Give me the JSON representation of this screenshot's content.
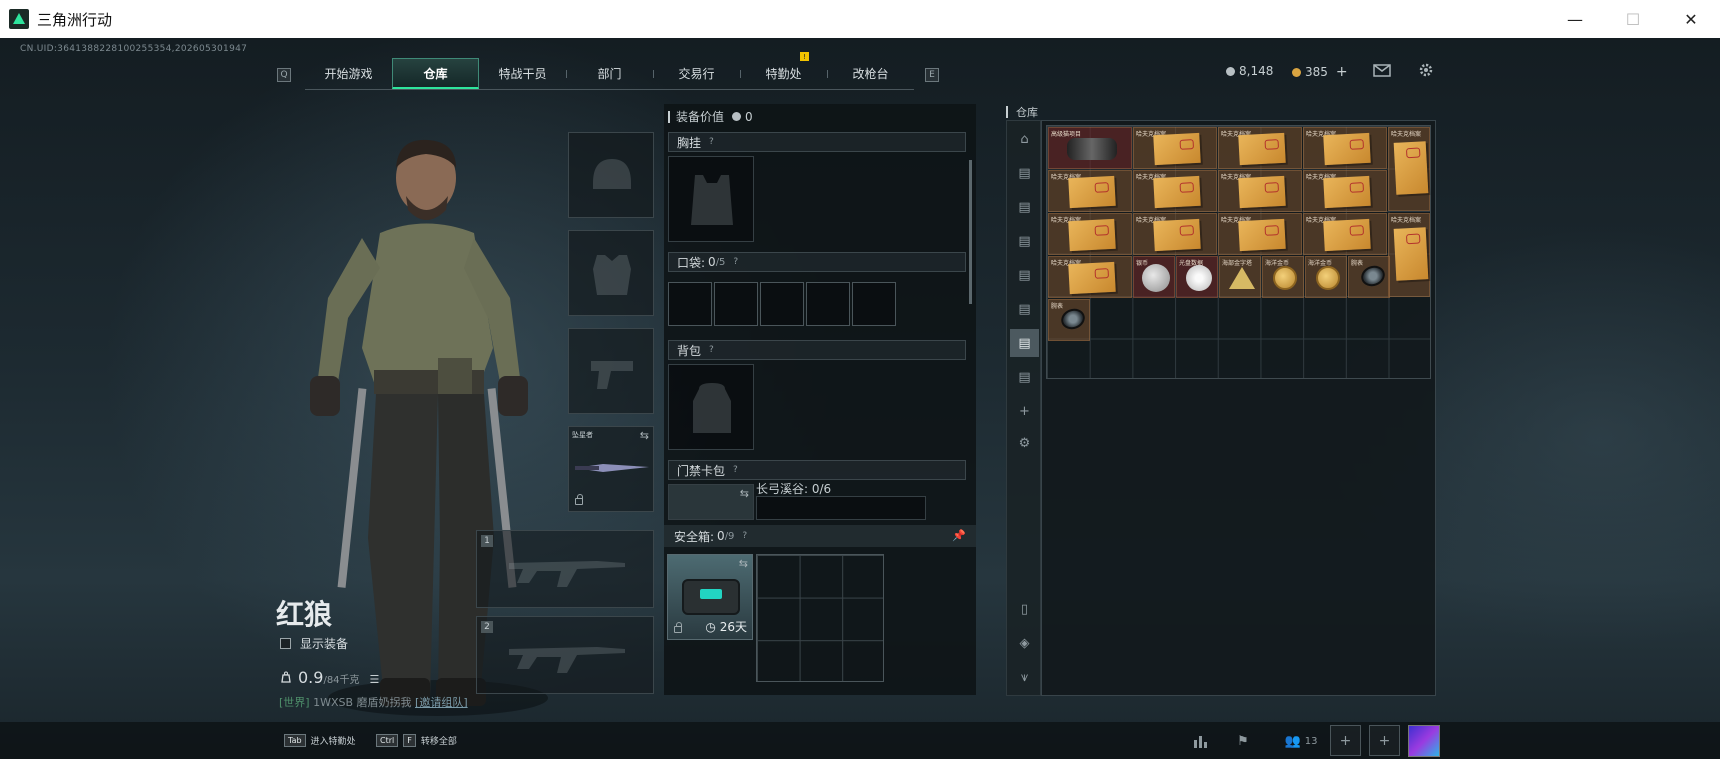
{
  "window": {
    "title": "三角洲行动",
    "minimize": "—",
    "maximize": "☐",
    "close": "✕"
  },
  "uid": "CN.UID:3641388228100255354,202605301947",
  "nav": {
    "left_key": "Q",
    "right_key": "E",
    "tabs": [
      {
        "label": "开始游戏"
      },
      {
        "label": "仓库",
        "active": true
      },
      {
        "label": "特战干员"
      },
      {
        "label": "部门"
      },
      {
        "label": "交易行"
      },
      {
        "label": "特勤处",
        "badge": "!"
      },
      {
        "label": "改枪台"
      }
    ]
  },
  "currency": {
    "silver": "8,148",
    "gold": "385",
    "add": "+"
  },
  "character": {
    "name": "红狼",
    "show_gear_label": "显示装备",
    "weight_value": "0.9",
    "weight_max": "/84千克"
  },
  "chat": {
    "channel": "[世界]",
    "user": "1WXSB",
    "message": " 磨盾奶拐我",
    "link": "[邀请组队]"
  },
  "gear_slots": {
    "melee_label": "坠星者",
    "weapon1": "1",
    "weapon2": "2"
  },
  "equipment": {
    "value_label": "装备价值",
    "value": "0",
    "chest_label": "胸挂",
    "pocket_label": "口袋:",
    "pocket_count": "0",
    "pocket_cap": "/5",
    "backpack_label": "背包",
    "keycard_label": "门禁卡包",
    "keycard_name": "长弓溪谷: 0/6",
    "safe_label": "安全箱:",
    "safe_count": "0",
    "safe_cap": "/9",
    "safe_days": "26天",
    "help": "?"
  },
  "storage": {
    "title": "仓库",
    "items": [
      {
        "label": "高级猫项目",
        "kind": "red"
      },
      {
        "label": "哈夫克档案"
      },
      {
        "label": "哈夫克档案"
      },
      {
        "label": "哈夫克档案"
      },
      {
        "label": "哈夫克档案"
      },
      {
        "label": "哈夫克档案"
      },
      {
        "label": "哈夫克档案"
      },
      {
        "label": "哈夫克档案"
      },
      {
        "label": "哈夫克档案"
      },
      {
        "label": "哈夫克档案"
      },
      {
        "label": "哈夫克档案"
      },
      {
        "label": "哈夫克档案"
      },
      {
        "label": "哈夫克档案"
      },
      {
        "label": "哈夫克档案"
      },
      {
        "label": "哈夫克档案"
      },
      {
        "label": "银币"
      },
      {
        "label": "光盘数据"
      },
      {
        "label": "海部金字塔"
      },
      {
        "label": "海洋金币"
      },
      {
        "label": "海洋金币"
      },
      {
        "label": "腕表"
      },
      {
        "label": "腕表"
      }
    ]
  },
  "bottom": {
    "hint1_key": "Tab",
    "hint1_label": "进入特勤处",
    "hint2_key1": "Ctrl",
    "hint2_key2": "F",
    "hint2_label": "转移全部",
    "friends_count": "13"
  }
}
